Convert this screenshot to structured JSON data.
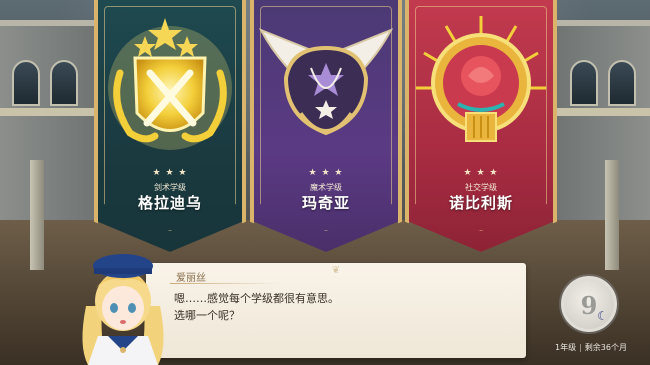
{
  "houses": [
    {
      "subtitle": "剑术学级",
      "name": "格拉迪乌",
      "color": "#1e4a50"
    },
    {
      "subtitle": "魔术学级",
      "name": "玛奇亚",
      "color": "#5b3a84"
    },
    {
      "subtitle": "社交学级",
      "name": "诺比利斯",
      "color": "#b33246"
    }
  ],
  "dialogue": {
    "speaker": "爱丽丝",
    "line1": "嗯……感觉每个学级都很有意思。",
    "line2": "选哪一个呢？"
  },
  "calendar": {
    "day": "9",
    "grade": "1年级",
    "separator": "|",
    "remaining": "剩余36个月"
  },
  "icons": {
    "house1": "crossed-swords-shield-icon",
    "house2": "winged-stars-icon",
    "house3": "rose-sun-icon",
    "moon": "moon-icon"
  }
}
